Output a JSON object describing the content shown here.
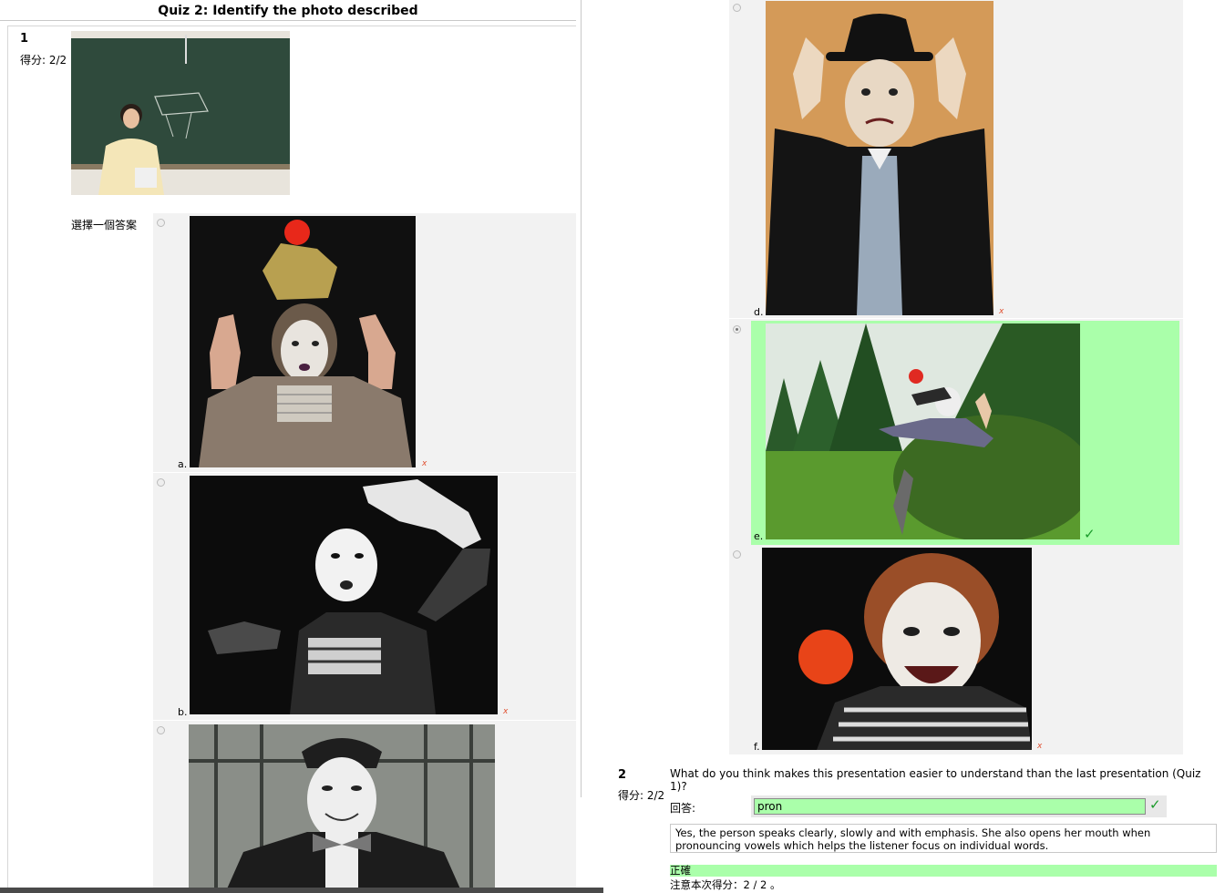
{
  "quiz": {
    "title": "Quiz 2: Identify the photo described"
  },
  "q1": {
    "number": "1",
    "score": "得分: 2/2",
    "prompt": "選擇一個答案",
    "options": [
      {
        "letter": "a.",
        "result": "x",
        "selected": false
      },
      {
        "letter": "b.",
        "result": "x",
        "selected": false
      },
      {
        "letter": "c.",
        "result": "",
        "selected": false
      },
      {
        "letter": "d.",
        "result": "x",
        "selected": false
      },
      {
        "letter": "e.",
        "result": "✓",
        "selected": true
      },
      {
        "letter": "f.",
        "result": "x",
        "selected": false
      }
    ]
  },
  "q2": {
    "number": "2",
    "score": "得分: 2/2",
    "question": "What do you think makes this presentation easier to understand than the last presentation (Quiz 1)?",
    "answer_label": "回答:",
    "answer_value": "pron",
    "feedback": "Yes, the person speaks clearly, slowly and with emphasis. She also opens her mouth when pronouncing vowels which helps the listener focus on individual words.",
    "result": "正確",
    "score_note": "注意本次得分：2 / 2 。"
  },
  "colors": {
    "correct": "#aaffaa",
    "option_bg": "#f2f2f2",
    "check": "#1a9a2a",
    "cross": "#e05030"
  },
  "icons": {
    "correct": "check-icon",
    "incorrect": "cross-icon"
  }
}
